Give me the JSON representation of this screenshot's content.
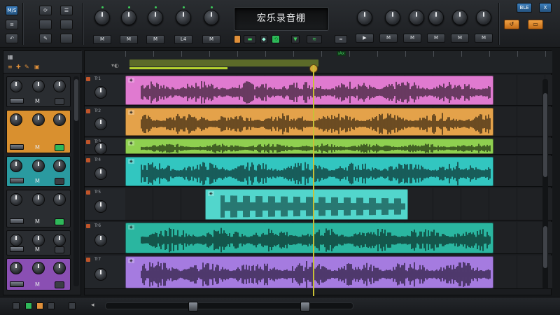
{
  "app": {
    "display_title": "宏乐录音棚"
  },
  "topbar": {
    "left_buttons": [
      "M/S",
      "≡",
      "↶",
      "⟳",
      "☰",
      "✎"
    ],
    "knob_labels_left": [
      "M",
      "M",
      "M",
      "L4",
      "M"
    ],
    "knob_labels_right": [
      "M",
      "M",
      "M",
      "M",
      "M",
      "M"
    ],
    "transport": {
      "play_symbol": "▶",
      "rec_symbol": "◉",
      "loop_label": "⟲"
    },
    "window_buttons": {
      "mode": "BLE",
      "close": "X"
    },
    "orange_labels": [
      "↺",
      "▭"
    ]
  },
  "mixer": {
    "header_icons": [
      "▦",
      "≡",
      "✚",
      "✎",
      "▣"
    ],
    "strips": [
      {
        "label": "M",
        "color": "#3a3e44"
      },
      {
        "label": "M",
        "color": "#d9902f"
      },
      {
        "label": "M",
        "color": "#2a9aa0"
      },
      {
        "label": "M",
        "color": "#3a3e44"
      },
      {
        "label": "M",
        "color": "#3a3e44"
      },
      {
        "label": "M",
        "color": "#8a4fb3"
      }
    ]
  },
  "timeline": {
    "ruler_marker": "ıAx",
    "tracks": [
      {
        "name": "Tr1",
        "color": "#e07ad0",
        "wave": "#1a0f18"
      },
      {
        "name": "Tr2",
        "color": "#e4a24a",
        "wave": "#1b1208"
      },
      {
        "name": "Tr3",
        "color": "#8fd050",
        "wave": "#0e1708"
      },
      {
        "name": "Tr4",
        "color": "#32c6c0",
        "wave": "#071716"
      },
      {
        "name": "Tr5",
        "color": "#52d6cc",
        "wave": "#0e3a37"
      },
      {
        "name": "Tr6",
        "color": "#2ab6a0",
        "wave": "#061613"
      },
      {
        "name": "Tr7",
        "color": "#a57be0",
        "wave": "#150d1f"
      }
    ]
  },
  "colors": {
    "accent_playhead": "#c8c036",
    "loop_green": "#b5d22f",
    "orange": "#e0903a"
  }
}
